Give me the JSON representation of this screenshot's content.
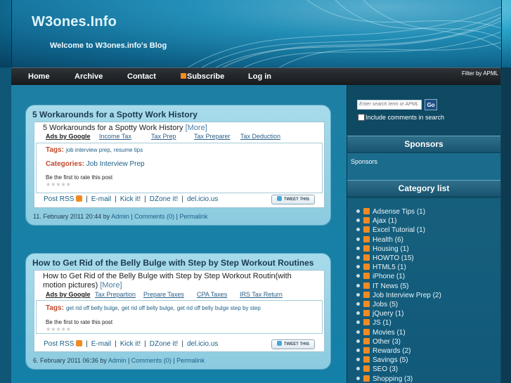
{
  "site": {
    "title": "W3ones.Info",
    "subtitle": "Welcome to W3ones.info's Blog"
  },
  "nav": {
    "items": [
      "Home",
      "Archive",
      "Contact",
      "Subscribe",
      "Log in"
    ],
    "filter": "Filter by APML"
  },
  "posts": [
    {
      "title": "5 Workarounds for a Spotty Work History",
      "headline": "5 Workarounds for a Spotty Work History",
      "more": "[More]",
      "ads_label": "Ads by Google",
      "ads": [
        "Income Tax",
        "Tax Prep",
        "Tax Preparer",
        "Tax Deduction"
      ],
      "tags_label": "Tags:",
      "tags": [
        "job interview prep",
        "resume tips"
      ],
      "categories_label": "Categories:",
      "categories": "Job Interview Prep",
      "rate_text": "Be the first to rate this post",
      "stars": "★★★★★",
      "share": [
        "Post RSS",
        "E-mail",
        "Kick it!",
        "DZone it!",
        "del.icio.us"
      ],
      "tweet": "TWEET THIS",
      "footer_date": "11. February 2011 20:44 by",
      "footer_author": "Admin",
      "footer_comments": "Comments (0)",
      "footer_permalink": "Permalink"
    },
    {
      "title": "How to Get Rid of the Belly Bulge with Step by Step Workout Routines",
      "headline": "How to Get Rid of the Belly Bulge with Step by Step Workout Routin(with motion pictures)",
      "more": "[More]",
      "ads_label": "Ads by Google",
      "ads": [
        "Tax Prepartion",
        "Prepare Taxes",
        "CPA Taxes",
        "IRS Tax Return"
      ],
      "tags_label": "Tags:",
      "tags": [
        "get rid off belly bulge",
        "get rid off belly bulge",
        "get rid off belly bulge step by step"
      ],
      "rate_text": "Be the first to rate this post",
      "stars": "★★★★★",
      "share": [
        "Post RSS",
        "E-mail",
        "Kick it!",
        "DZone it!",
        "del.icio.us"
      ],
      "tweet": "TWEET THIS",
      "footer_date": "6. February 2011 06:36 by",
      "footer_author": "Admin",
      "footer_comments": "Comments (0)",
      "footer_permalink": "Permalink"
    }
  ],
  "sidebar": {
    "search_placeholder": "Enter search term or APML url",
    "go": "Go",
    "include_comments": "Include comments in search",
    "sponsors_heading": "Sponsors",
    "sponsors_text": "Sponsors",
    "category_heading": "Category list",
    "categories": [
      "Adsense Tips (1)",
      "Ajax (1)",
      "Excel Tutorial (1)",
      "Health (6)",
      "Housing (1)",
      "HOWTO (15)",
      "HTML5 (1)",
      "iPhone (1)",
      "IT News (5)",
      "Job Interview Prep (2)",
      "Jobs (5)",
      "jQuery (1)",
      "JS (1)",
      "Movies (1)",
      "Other (3)",
      "Rewards (2)",
      "Savings (5)",
      "SEO (3)",
      "Shopping (3)"
    ]
  },
  "colors": {
    "header": "#1f8fb8",
    "nav": "#1d2024",
    "content": "#1680a7",
    "sidebar": "#0f4a63",
    "rss": "#f28a23"
  }
}
